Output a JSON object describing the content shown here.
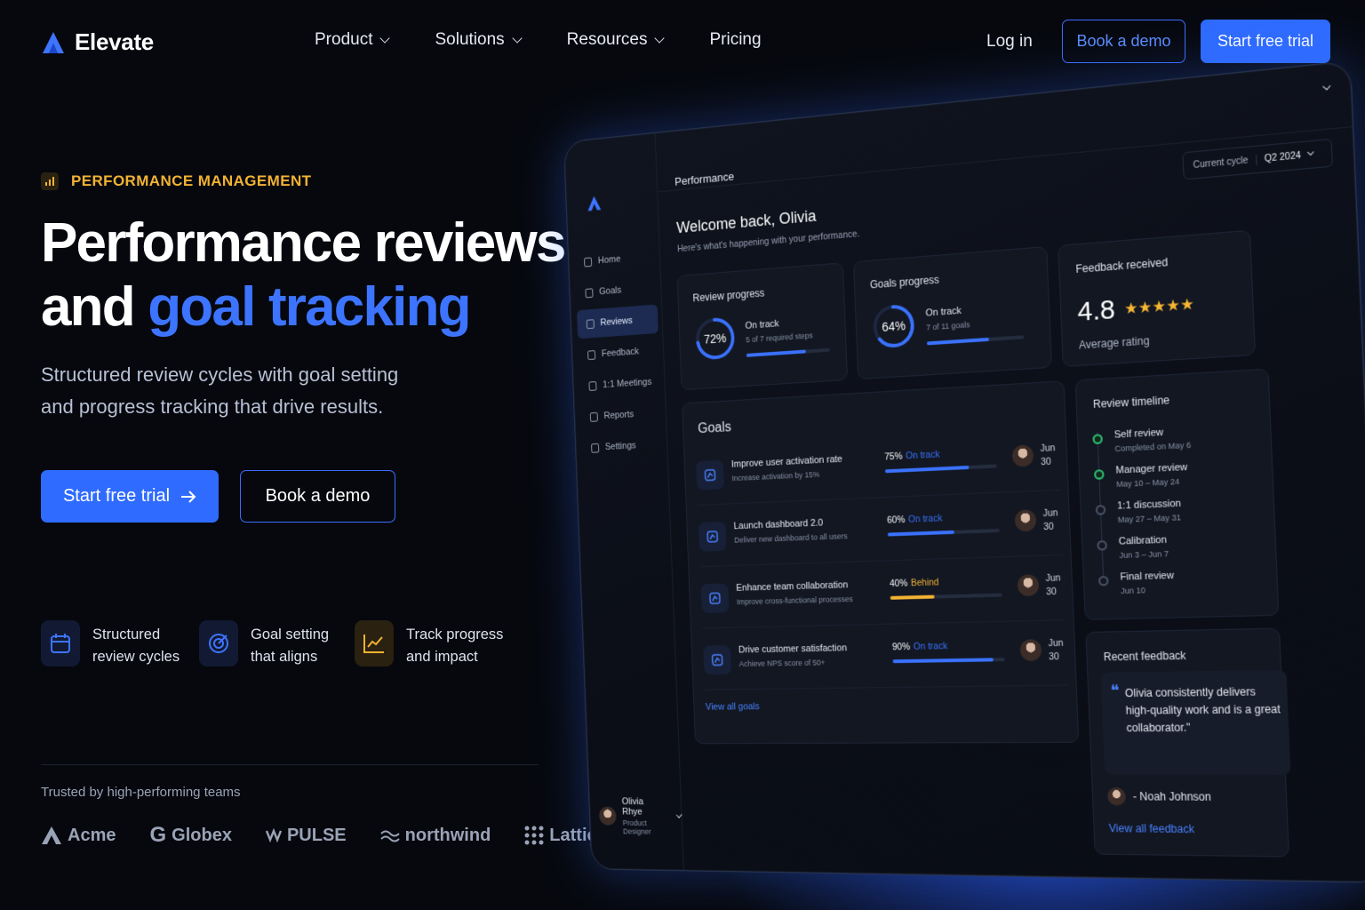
{
  "brand": {
    "name": "Elevate",
    "accent": "#3d74ff"
  },
  "nav": {
    "links": [
      "Product",
      "Solutions",
      "Resources",
      "Pricing"
    ],
    "login": "Log in",
    "demo": "Book a demo",
    "trial": "Start free trial"
  },
  "hero": {
    "eyebrow": "PERFORMANCE MANAGEMENT",
    "title_line1": "Performance reviews",
    "title_line2_plain": "and ",
    "title_line2_accent": "goal tracking",
    "subtitle": "Structured review cycles with goal setting and progress tracking that drive results.",
    "cta_primary": "Start free trial",
    "cta_secondary": "Book a demo"
  },
  "features": [
    {
      "line1": "Structured",
      "line2": "review cycles",
      "icon": "calendar-icon",
      "color": "#3d74ff"
    },
    {
      "line1": "Goal setting",
      "line2": "that aligns",
      "icon": "target-icon",
      "color": "#3d74ff"
    },
    {
      "line1": "Track progress",
      "line2": "and impact",
      "icon": "chart-icon",
      "color": "#f2b233"
    }
  ],
  "trusted": {
    "label": "Trusted by high-performing teams",
    "logos": [
      "Acme",
      "Globex",
      "PULSE",
      "northwind",
      "Lattice"
    ]
  },
  "dashboard": {
    "sidebar": [
      "Home",
      "Goals",
      "Reviews",
      "Feedback",
      "1:1 Meetings",
      "Reports",
      "Settings"
    ],
    "active_item": "Reviews",
    "user": {
      "name": "Olivia Rhye",
      "role": "Product Designer"
    },
    "header_title": "Performance",
    "cycle_label": "Current cycle",
    "cycle_value": "Q2 2024",
    "welcome": "Welcome back, Olivia",
    "welcome_sub": "Here's what's happening with your performance.",
    "review_progress": {
      "title": "Review progress",
      "percent_label": "72%",
      "percent": 72,
      "status": "On track",
      "detail": "5 of 7 required steps"
    },
    "goals_progress": {
      "title": "Goals progress",
      "percent_label": "64%",
      "percent": 64,
      "status": "On track",
      "detail": "7 of 11 goals"
    },
    "feedback": {
      "title": "Feedback received",
      "rating": "4.8",
      "stars": "★★★★★",
      "label": "Average rating"
    },
    "goals_title": "Goals",
    "goals": [
      {
        "name": "Improve user activation rate",
        "desc": "Increase activation by 15%",
        "pct_label": "75%",
        "pct": 75,
        "status": "On track",
        "date1": "Jun",
        "date2": "30"
      },
      {
        "name": "Launch dashboard 2.0",
        "desc": "Deliver new dashboard to all users",
        "pct_label": "60%",
        "pct": 60,
        "status": "On track",
        "date1": "Jun",
        "date2": "30"
      },
      {
        "name": "Enhance team collaboration",
        "desc": "Improve cross-functional processes",
        "pct_label": "40%",
        "pct": 40,
        "status": "Behind",
        "date1": "Jun",
        "date2": "30"
      },
      {
        "name": "Drive customer satisfaction",
        "desc": "Achieve NPS score of 50+",
        "pct_label": "90%",
        "pct": 90,
        "status": "On track",
        "date1": "Jun",
        "date2": "30"
      }
    ],
    "view_goals": "View all goals",
    "timeline_title": "Review timeline",
    "timeline": [
      {
        "name": "Self review",
        "date": "Completed on May 6",
        "state": "done"
      },
      {
        "name": "Manager review",
        "date": "May 10 – May 24",
        "state": "done"
      },
      {
        "name": "1:1 discussion",
        "date": "May 27 – May 31",
        "state": "pending"
      },
      {
        "name": "Calibration",
        "date": "Jun 3 – Jun 7",
        "state": "pending"
      },
      {
        "name": "Final review",
        "date": "Jun 10",
        "state": "pending"
      }
    ],
    "recent_feedback_title": "Recent feedback",
    "quote": "Olivia consistently delivers high-quality work and is a great collaborator.\"",
    "quote_author": "- Noah Johnson",
    "view_feedback": "View all feedback",
    "colors": {
      "on_track": "#3a72ff",
      "behind": "#f2b233",
      "done": "#2fbf71"
    }
  }
}
